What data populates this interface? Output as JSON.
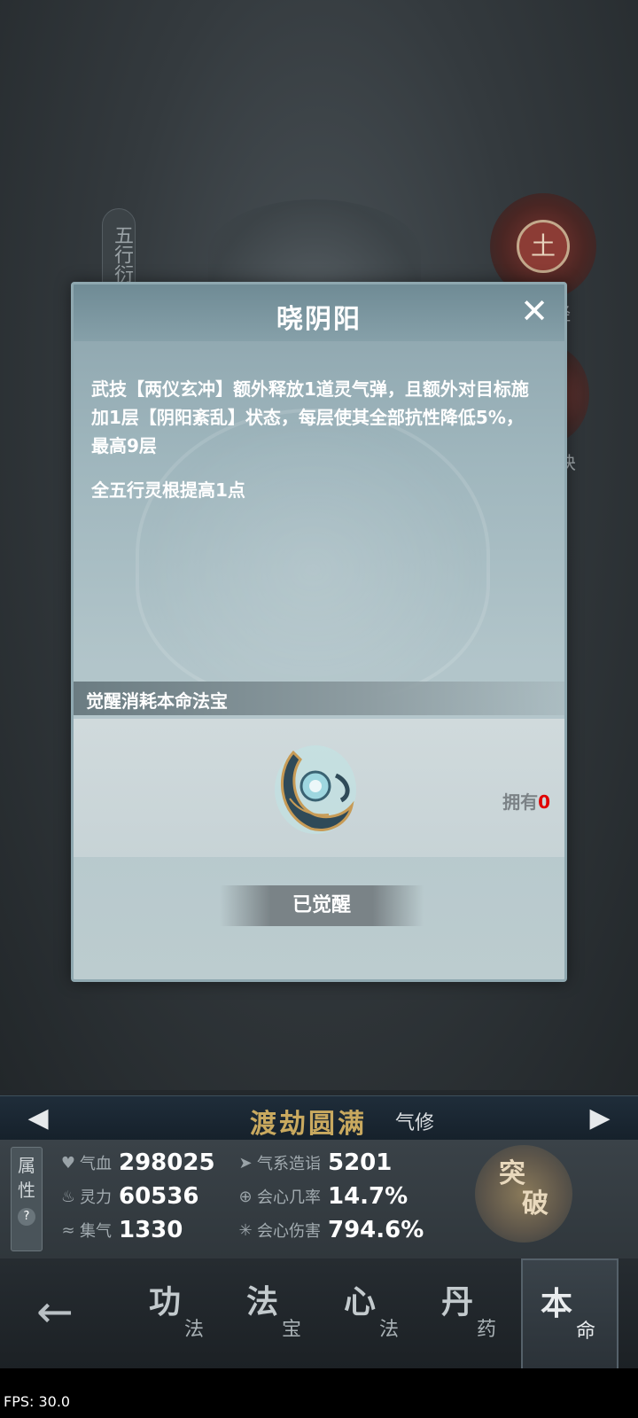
{
  "background": {
    "vertical_tab_text": "五行衍",
    "orb_char": "土",
    "side_label_1": "经",
    "side_label_2": "诀"
  },
  "modal": {
    "title": "晓阴阳",
    "close_icon": "close-x",
    "description": "武技【两仪玄冲】额外释放1道灵气弹，且额外对目标施加1层【阴阳紊乱】状态，每层使其全部抗性降低5%，最高9层",
    "bonus": "全五行灵根提高1点",
    "section_label": "觉醒消耗本命法宝",
    "owned_label": "拥有",
    "owned_count": "0",
    "button_label": "已觉醒"
  },
  "realm": {
    "name": "渡劫圆满",
    "type": "气修"
  },
  "stats": {
    "tab_label_1": "属",
    "tab_label_2": "性",
    "tab_help": "?",
    "items": [
      {
        "label": "气血",
        "value": "298025",
        "icon": "heart-icon"
      },
      {
        "label": "灵力",
        "value": "60536",
        "icon": "flame-icon"
      },
      {
        "label": "集气",
        "value": "1330",
        "icon": "swirl-icon"
      },
      {
        "label": "气系造诣",
        "value": "5201",
        "icon": "wind-icon"
      },
      {
        "label": "会心几率",
        "value": "14.7%",
        "icon": "crit-rate-icon"
      },
      {
        "label": "会心伤害",
        "value": "794.6%",
        "icon": "crit-damage-icon"
      }
    ],
    "breakthrough_1": "突",
    "breakthrough_2": "破"
  },
  "nav": {
    "tabs": [
      {
        "main": "功",
        "sub": "法"
      },
      {
        "main": "法",
        "sub": "宝"
      },
      {
        "main": "心",
        "sub": "法"
      },
      {
        "main": "丹",
        "sub": "药"
      },
      {
        "main": "本",
        "sub": "命"
      }
    ],
    "active_index": 4
  },
  "fps": "FPS: 30.0",
  "colors": {
    "accent_gold": "#c9a95f",
    "owned_zero": "#e00000",
    "modal_bg": "#9fb6bd"
  }
}
